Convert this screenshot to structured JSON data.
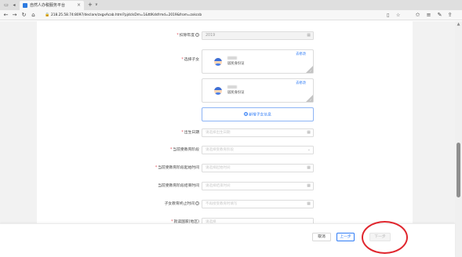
{
  "browser": {
    "tab_title": "自然人办税服务平台",
    "url": "218.25.58.74:8097/declare/zxgxAcab.html?pjdclsDm=1&ttlKdsfrmd=2019&from=zxkcsb",
    "new_tab": "+",
    "tab_list": "∨"
  },
  "form": {
    "deduction_year": {
      "label": "扣除年度",
      "value": "2019"
    },
    "select_child": {
      "label": "选择子女"
    },
    "children": [
      {
        "id_label": "居民身份证",
        "action": "去修改"
      },
      {
        "id_label": "居民身份证",
        "action": "去修改"
      }
    ],
    "add_child": {
      "label": "新增子女信息",
      "plus": "+"
    },
    "birth_date": {
      "label": "出生日期",
      "placeholder": "请选择出生日期"
    },
    "education_stage": {
      "label": "当前受教育阶段",
      "placeholder": "请选择受教育阶段"
    },
    "education_start": {
      "label": "当前受教育阶段起始时间",
      "placeholder": "请选择起始时间"
    },
    "education_end": {
      "label": "当前受教育阶段结束时间",
      "placeholder": "请选择结束时间"
    },
    "education_termination": {
      "label": "子女教育终止时间",
      "placeholder": "不再接受教育时填写"
    },
    "school_country": {
      "label": "就读国家(地区)",
      "placeholder": "请选择"
    },
    "required_mark": "*",
    "help_mark": "?"
  },
  "footer": {
    "cancel": "取消",
    "prev": "上一步",
    "next": "下一步"
  },
  "colors": {
    "accent": "#2f7cf6",
    "required": "#e34d59",
    "annotation_circle": "#e0262e"
  }
}
